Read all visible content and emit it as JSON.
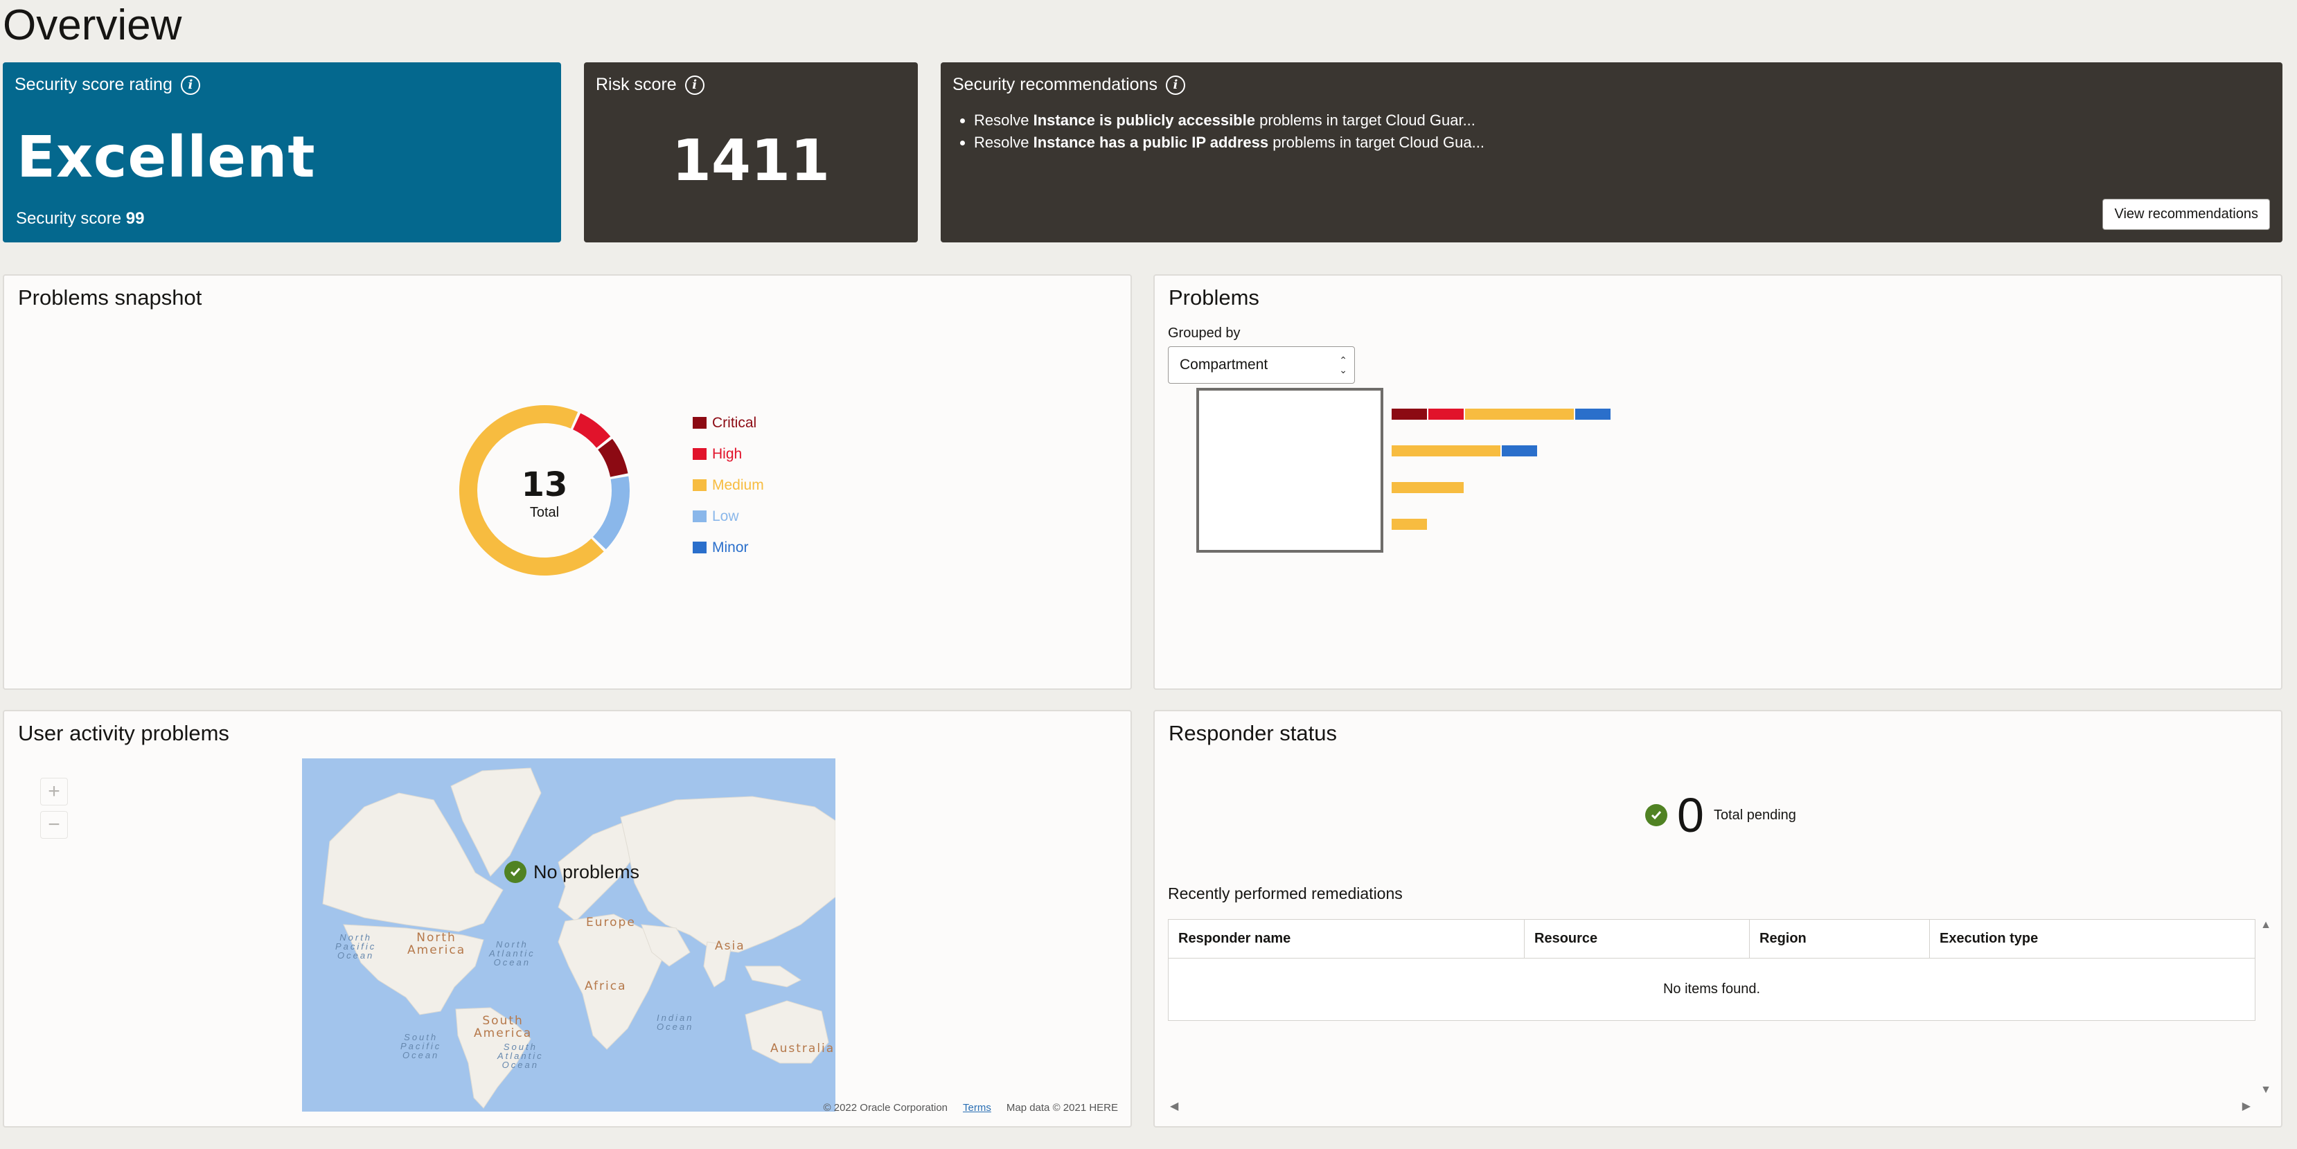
{
  "page": {
    "title": "Overview"
  },
  "score_card": {
    "title": "Security score rating",
    "rating": "Excellent",
    "score_label": "Security score",
    "score_value": "99",
    "bg": "#04688e"
  },
  "risk_card": {
    "title": "Risk score",
    "value": "1411"
  },
  "recommendations": {
    "title": "Security recommendations",
    "items": [
      {
        "prefix": "Resolve ",
        "bold": "Instance is publicly accessible",
        "suffix": " problems in target Cloud Guar..."
      },
      {
        "prefix": "Resolve ",
        "bold": "Instance has a public IP address",
        "suffix": " problems in target Cloud Gua..."
      }
    ],
    "button": "View recommendations"
  },
  "snapshot": {
    "title": "Problems snapshot",
    "total": "13",
    "total_label": "Total",
    "legend": [
      {
        "label": "Critical",
        "color": "#8c0a13"
      },
      {
        "label": "High",
        "color": "#e1132b"
      },
      {
        "label": "Medium",
        "color": "#f7bc40"
      },
      {
        "label": "Low",
        "color": "#8ab7ea"
      },
      {
        "label": "Minor",
        "color": "#2a6fcb"
      }
    ]
  },
  "chart_data": [
    {
      "type": "pie",
      "title": "Problems snapshot",
      "categories": [
        "Critical",
        "High",
        "Medium",
        "Low",
        "Minor"
      ],
      "values": [
        1,
        1,
        9,
        2,
        0
      ],
      "colors": [
        "#8c0a13",
        "#e1132b",
        "#f7bc40",
        "#8ab7ea",
        "#2a6fcb"
      ]
    },
    {
      "type": "bar",
      "title": "Problems",
      "categories": [
        "",
        "",
        "",
        ""
      ],
      "series": [
        {
          "values": [
            1,
            0,
            0,
            0
          ],
          "color": "#8c0a13"
        },
        {
          "values": [
            1,
            0,
            0,
            0
          ],
          "color": "#e1132b"
        },
        {
          "values": [
            3,
            3,
            2,
            1
          ],
          "color": "#f7bc40"
        },
        {
          "values": [
            1,
            1,
            0,
            0
          ],
          "color": "#2a6fcb"
        }
      ]
    }
  ],
  "problems": {
    "title": "Problems",
    "grouped_by_label": "Grouped by",
    "grouped_by_value": "Compartment"
  },
  "user_activity": {
    "title": "User activity problems",
    "zoom_in": "+",
    "zoom_out": "−",
    "overlay_text": "No problems",
    "credits": {
      "copyright": "© 2022 Oracle Corporation",
      "terms": "Terms",
      "map_data": "Map data © 2021 HERE"
    },
    "labels": {
      "north_america": "North\nAmerica",
      "south_america": "South\nAmerica",
      "europe": "Europe",
      "africa": "Africa",
      "asia": "Asia",
      "australia": "Australia",
      "north_pacific": "North\nPacific\nOcean",
      "north_atlantic": "North\nAtlantic\nOcean",
      "south_pacific": "South\nPacific\nOcean",
      "south_atlantic": "South\nAtlantic\nOcean",
      "indian": "Indian\nOcean"
    }
  },
  "responder": {
    "title": "Responder status",
    "pending_count": "0",
    "pending_label": "Total pending",
    "recent_title": "Recently performed remediations",
    "columns": [
      "Responder name",
      "Resource",
      "Region",
      "Execution type"
    ],
    "empty_text": "No items found."
  }
}
